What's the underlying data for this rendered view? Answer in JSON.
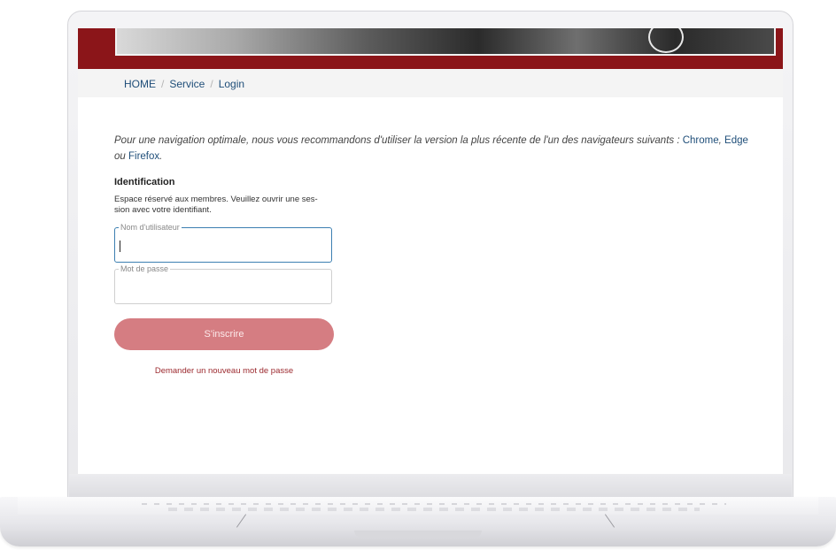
{
  "breadcrumb": {
    "home": "HOME",
    "separator": "/",
    "service": "Service",
    "current": "Login"
  },
  "notice": {
    "text": "Pour une navigation optimale, nous vous recommandons d'utiliser la version la plus récente de l'un des navigateurs suivants : ",
    "browser_chrome": "Chrome",
    "comma": ", ",
    "browser_edge": "Edge",
    "or": " ou ",
    "browser_firefox": "Firefox",
    "period": "."
  },
  "identification": {
    "title": "Identification",
    "description": "Espace réservé aux membres. Veuillez ouvrir une ses-sion avec votre identifiant."
  },
  "form": {
    "username_label": "Nom d'utilisateur",
    "username_value": "",
    "password_label": "Mot de passe",
    "password_value": "",
    "submit_label": "S'inscrire",
    "forgot_label": "Demander un nouveau mot de passe"
  },
  "colors": {
    "banner": "#8b1519",
    "link": "#1f4e79",
    "button": "#d57d82",
    "focus": "#3c7fb1"
  }
}
